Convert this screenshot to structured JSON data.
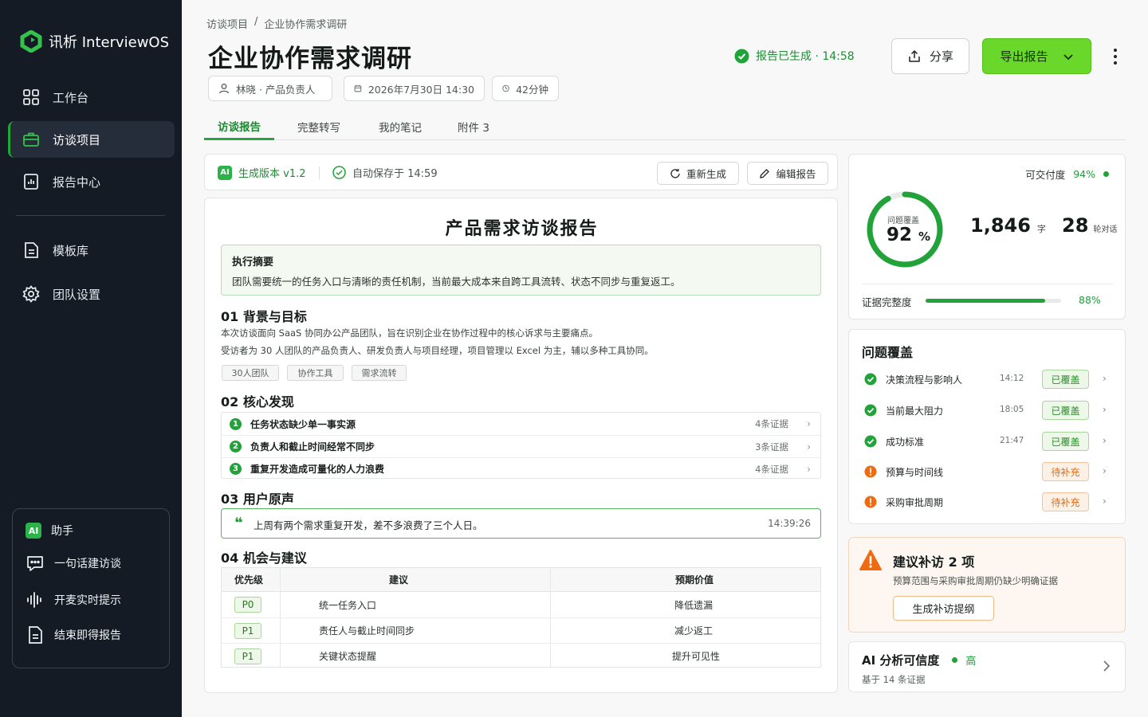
{
  "app": {
    "name": "讯析 InterviewOS"
  },
  "sidebar": {
    "items": [
      {
        "label": "工作台",
        "icon": "grid-icon"
      },
      {
        "label": "访谈项目",
        "icon": "briefcase-icon",
        "active": true
      },
      {
        "label": "报告中心",
        "icon": "report-icon"
      },
      {
        "label": "模板库",
        "icon": "document-icon"
      },
      {
        "label": "团队设置",
        "icon": "gear-icon"
      }
    ],
    "assistant": {
      "badge": "AI",
      "title": "助手",
      "items": [
        {
          "label": "一句话建访谈",
          "icon": "chat-icon"
        },
        {
          "label": "开麦实时提示",
          "icon": "waveform-icon"
        },
        {
          "label": "结束即得报告",
          "icon": "document-icon"
        }
      ]
    }
  },
  "header": {
    "breadcrumb": [
      "访谈项目",
      "/",
      "企业协作需求调研"
    ],
    "title": "企业协作需求调研",
    "meta": {
      "person": "林晓 · 产品负责人",
      "date": "2026年7月30日 14:30",
      "duration": "42分钟"
    },
    "status": "报告已生成 · 14:58",
    "share_label": "分享",
    "export_label": "导出报告"
  },
  "tabs": [
    {
      "label": "访谈报告",
      "active": true
    },
    {
      "label": "完整转写"
    },
    {
      "label": "我的笔记"
    },
    {
      "label": "附件 3"
    }
  ],
  "toolbar": {
    "ai_badge": "AI",
    "version": "生成版本 v1.2",
    "autosave": "自动保存于 14:59",
    "regenerate_label": "重新生成",
    "edit_label": "编辑报告"
  },
  "report": {
    "title": "产品需求访谈报告",
    "summary": {
      "heading": "执行摘要",
      "text": "团队需要统一的任务入口与清晰的责任机制，当前最大成本来自跨工具流转、状态不同步与重复返工。"
    },
    "s1": {
      "heading": "01  背景与目标",
      "p1": "本次访谈面向 SaaS 协同办公产品团队，旨在识别企业在协作过程中的核心诉求与主要痛点。",
      "p2": "受访者为 30 人团队的产品负责人、研发负责人与项目经理，项目管理以 Excel 为主，辅以多种工具协同。",
      "tags": [
        "30人团队",
        "协作工具",
        "需求流转"
      ]
    },
    "s2": {
      "heading": "02  核心发现",
      "items": [
        {
          "num": "1",
          "text": "任务状态缺少单一事实源",
          "evidence": "4条证据"
        },
        {
          "num": "2",
          "text": "负责人和截止时间经常不同步",
          "evidence": "3条证据"
        },
        {
          "num": "3",
          "text": "重复开发造成可量化的人力浪费",
          "evidence": "4条证据"
        }
      ]
    },
    "s3": {
      "heading": "03  用户原声",
      "quote_mark": "❝",
      "quote": "上周有两个需求重复开发，差不多浪费了三个人日。",
      "timestamp": "14:39:26"
    },
    "s4": {
      "heading": "04  机会与建议",
      "columns": [
        "优先级",
        "建议",
        "预期价值"
      ],
      "rows": [
        {
          "priority": "P0",
          "suggestion": "统一任务入口",
          "value": "降低遗漏"
        },
        {
          "priority": "P1",
          "suggestion": "责任人与截止时间同步",
          "value": "减少返工"
        },
        {
          "priority": "P1",
          "suggestion": "关键状态提醒",
          "value": "提升可见性"
        }
      ]
    }
  },
  "stats": {
    "credibility_label": "可交付度",
    "credibility_value": "94%",
    "coverage_label": "问题覆盖",
    "coverage_value": "92",
    "coverage_unit": "%",
    "coverage_fraction": 0.92,
    "words": "1,846",
    "words_unit": "字",
    "turns": "28",
    "turns_unit": "轮对话",
    "evidence_label": "证据完整度",
    "evidence_value": "88%",
    "evidence_fraction": 0.88
  },
  "coverage": {
    "title": "问题覆盖",
    "items": [
      {
        "name": "决策流程与影响人",
        "time": "14:12",
        "status": "已覆盖",
        "state": "ok"
      },
      {
        "name": "当前最大阻力",
        "time": "18:05",
        "status": "已覆盖",
        "state": "ok"
      },
      {
        "name": "成功标准",
        "time": "21:47",
        "status": "已覆盖",
        "state": "ok"
      },
      {
        "name": "预算与时间线",
        "time": "",
        "status": "待补充",
        "state": "todo"
      },
      {
        "name": "采购审批周期",
        "time": "",
        "status": "待补充",
        "state": "todo"
      }
    ]
  },
  "followup": {
    "title": "建议补访 2 项",
    "desc": "预算范围与采购审批周期仍缺少明确证据",
    "button": "生成补访提纲"
  },
  "ai_confidence": {
    "title": "AI 分析可信度",
    "level": "高",
    "sub": "基于 14 条证据"
  },
  "colors": {
    "accent": "#22a33a",
    "export_button": "#6ad82a",
    "warning": "#e06a14",
    "sidebar": "#141b25"
  }
}
